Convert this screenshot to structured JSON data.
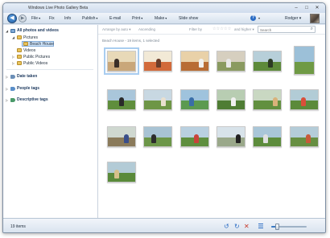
{
  "window": {
    "title": "Windows Live Photo Gallery Beta"
  },
  "menu": {
    "items": [
      {
        "id": "file",
        "label": "File",
        "caret": "▾"
      },
      {
        "id": "fix",
        "label": "Fix",
        "caret": ""
      },
      {
        "id": "info",
        "label": "Info",
        "caret": ""
      },
      {
        "id": "publish",
        "label": "Publish",
        "caret": "▾"
      },
      {
        "id": "email",
        "label": "E-mail",
        "caret": ""
      },
      {
        "id": "print",
        "label": "Print",
        "caret": "▾"
      },
      {
        "id": "make",
        "label": "Make",
        "caret": "▾"
      },
      {
        "id": "slideshow",
        "label": "Slide show",
        "caret": ""
      }
    ],
    "help_glyph": "?",
    "help_caret": "▾",
    "user": "Rodger ▾"
  },
  "sidebar": {
    "root_label": "All photos and videos",
    "folders": [
      {
        "label": "Pictures",
        "level": 1
      },
      {
        "label": "Beach House",
        "level": 2,
        "selected": true
      },
      {
        "label": "Videos",
        "level": 1
      },
      {
        "label": "Public Pictures",
        "level": 1
      },
      {
        "label": "Public Videos",
        "level": 1
      }
    ],
    "groups": [
      {
        "label": "Date taken"
      },
      {
        "label": "People tags"
      },
      {
        "label": "Descriptive tags"
      }
    ]
  },
  "filterbar": {
    "arrange": "Arrange by auto ▾",
    "order": "Ascending",
    "filter_by": "Filter by",
    "stars": "☆☆☆☆☆",
    "and_higher": "and higher ▾",
    "search_placeholder": "Search"
  },
  "breadcrumb": "Beach House - 19 items, 1 selected",
  "photos": [
    {
      "caption": "",
      "orientation": "landscape",
      "selected": true,
      "sky": "#e8d9b8",
      "ground": "#c9a77a",
      "fig": "#3a2e28"
    },
    {
      "caption": "",
      "orientation": "landscape",
      "selected": false,
      "sky": "#f2e9d6",
      "ground": "#d26a3a",
      "fig": "#6b3d2a"
    },
    {
      "caption": "",
      "orientation": "landscape",
      "selected": false,
      "sky": "#e9d1a8",
      "ground": "#b86c34",
      "fig": "#f0f0f0"
    },
    {
      "caption": "",
      "orientation": "landscape",
      "selected": false,
      "sky": "#d6cfbf",
      "ground": "#8a9a60",
      "fig": "#e8e8e8"
    },
    {
      "caption": "",
      "orientation": "landscape",
      "selected": false,
      "sky": "#b7cfd9",
      "ground": "#5d8a3a",
      "fig": "#2c3a24"
    },
    {
      "caption": "",
      "orientation": "portrait",
      "selected": false,
      "sky": "#9cc0d8",
      "ground": "#6f9a45",
      "fig": "#c84a3a"
    },
    {
      "caption": "",
      "orientation": "landscape",
      "selected": false,
      "sky": "#a9c6da",
      "ground": "#5f8e3c",
      "fig": "#2a2a2a"
    },
    {
      "caption": "",
      "orientation": "landscape",
      "selected": false,
      "sky": "#c8d8e2",
      "ground": "#6e9646",
      "fig": "#e9e0cf"
    },
    {
      "caption": "",
      "orientation": "landscape",
      "selected": false,
      "sky": "#9fc3dd",
      "ground": "#5c9a50",
      "fig": "#3a6ea8"
    },
    {
      "caption": "",
      "orientation": "landscape",
      "selected": false,
      "sky": "#b8cdb2",
      "ground": "#4f7d34",
      "fig": "#f0f0f0"
    },
    {
      "caption": "",
      "orientation": "landscape",
      "selected": false,
      "sky": "#c9d8c2",
      "ground": "#62903f",
      "fig": "#d9b27a"
    },
    {
      "caption": "",
      "orientation": "landscape",
      "selected": false,
      "sky": "#b2ccd6",
      "ground": "#5b8a3a",
      "fig": "#d94f3a"
    },
    {
      "caption": "",
      "orientation": "landscape",
      "selected": false,
      "sky": "#cfd8d0",
      "ground": "#8a7a5a",
      "fig": "#3a4e8a"
    },
    {
      "caption": "",
      "orientation": "landscape",
      "selected": false,
      "sky": "#a8c3d4",
      "ground": "#6c9648",
      "fig": "#2c2c2c"
    },
    {
      "caption": "",
      "orientation": "landscape",
      "selected": false,
      "sky": "#b9d0e0",
      "ground": "#5f8f3f",
      "fig": "#c9433a"
    },
    {
      "caption": "",
      "orientation": "landscape",
      "selected": false,
      "sky": "#d8e3ea",
      "ground": "#9aa88a",
      "fig": "#222222"
    },
    {
      "caption": "",
      "orientation": "landscape",
      "selected": false,
      "sky": "#a9c6d8",
      "ground": "#5d8c3c",
      "fig": "#e0e0e0"
    },
    {
      "caption": "",
      "orientation": "landscape",
      "selected": false,
      "sky": "#b4ccd8",
      "ground": "#678f42",
      "fig": "#c85a3a"
    },
    {
      "caption": "",
      "orientation": "landscape",
      "selected": false,
      "sky": "#b3cbd6",
      "ground": "#5a8a3a",
      "fig": "#d6c08a"
    }
  ],
  "status": {
    "count": "19 items"
  },
  "zoom": {
    "level": 0.18
  },
  "colors": {
    "accent": "#2b6cc4",
    "selection": "#cfe3f7"
  }
}
